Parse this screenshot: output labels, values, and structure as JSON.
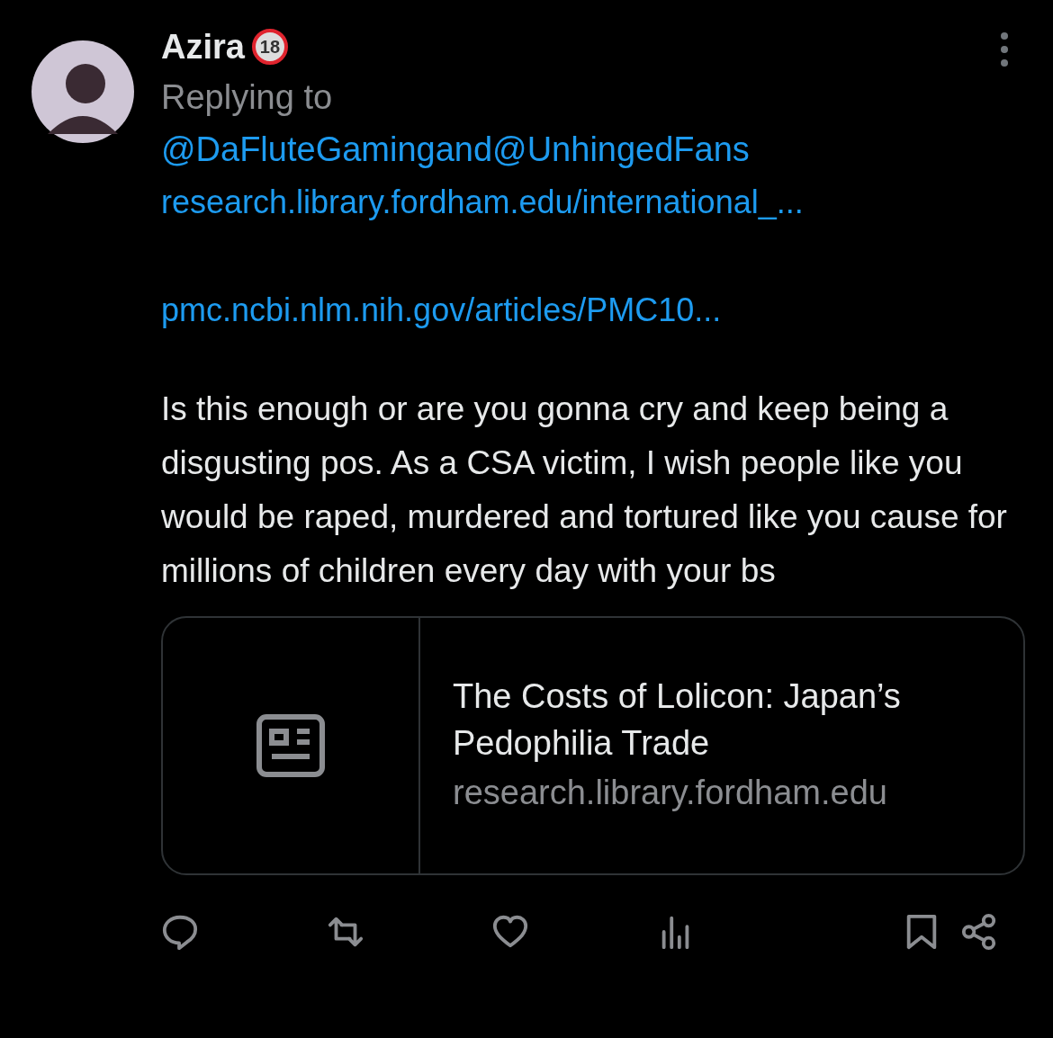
{
  "author": {
    "name": "Azira",
    "badge": "18"
  },
  "replying": {
    "prefix": "Replying to",
    "mentions": [
      "@DaFluteGaming",
      "@UnhingedFans"
    ],
    "joiner": "and"
  },
  "links": [
    "research.library.fordham.edu/international_...",
    "pmc.ncbi.nlm.nih.gov/articles/PMC10..."
  ],
  "body": "Is this enough or are you gonna cry and keep being a disgusting pos. As a CSA victim, I wish people like you would be raped, murdered and tortured like you cause for millions of children every day with your bs",
  "card": {
    "title": "The Costs of Lolicon: Japan’s Pedophilia Trade",
    "domain": "research.library.fordham.edu"
  },
  "actions": [
    {
      "kind": "reply"
    },
    {
      "kind": "repost"
    },
    {
      "kind": "like"
    },
    {
      "kind": "views"
    },
    {
      "kind": "bookmark"
    },
    {
      "kind": "share"
    }
  ]
}
